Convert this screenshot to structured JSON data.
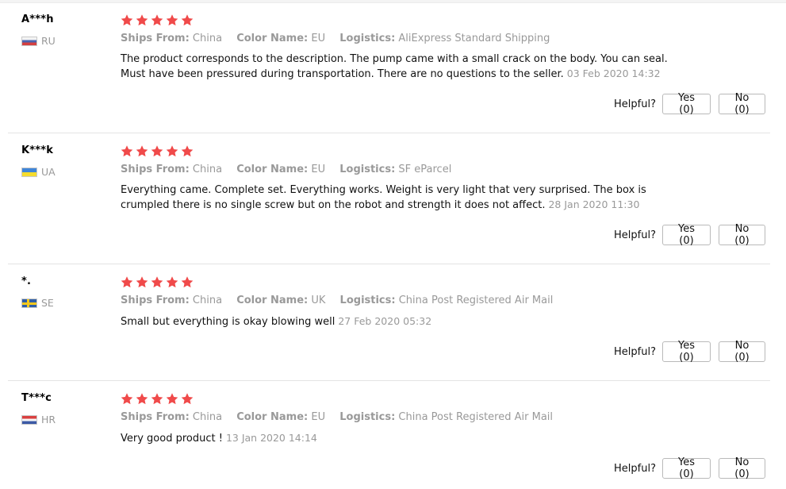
{
  "labels": {
    "ships_from": "Ships From:",
    "color_name": "Color Name:",
    "logistics": "Logistics:",
    "helpful": "Helpful?"
  },
  "colors": {
    "star": "#f04a4a",
    "muted_text": "#999999",
    "divider": "#e3e3e3"
  },
  "reviews": [
    {
      "user": "A***h",
      "country": "RU",
      "flag_icon": "russia-flag-icon",
      "rating": 5,
      "ships_from": "China",
      "color_name": "EU",
      "logistics": "AliExpress Standard Shipping",
      "text": "The product corresponds to the description. The pump came with a small crack on the body. You can seal. Must have been pressured during transportation. There are no questions to the seller.",
      "date": "03 Feb 2020 14:32",
      "yes_label": "Yes (0)",
      "no_label": "No (0)"
    },
    {
      "user": "K***k",
      "country": "UA",
      "flag_icon": "ukraine-flag-icon",
      "rating": 5,
      "ships_from": "China",
      "color_name": "EU",
      "logistics": "SF eParcel",
      "text": "Everything came. Complete set. Everything works. Weight is very light that very surprised. The box is crumpled there is no single screw but on the robot and strength it does not affect.",
      "date": "28 Jan 2020 11:30",
      "yes_label": "Yes (0)",
      "no_label": "No (0)"
    },
    {
      "user": "*.",
      "country": "SE",
      "flag_icon": "sweden-flag-icon",
      "rating": 5,
      "ships_from": "China",
      "color_name": "UK",
      "logistics": "China Post Registered Air Mail",
      "text": "Small but everything is okay blowing well",
      "date": "27 Feb 2020 05:32",
      "yes_label": "Yes (0)",
      "no_label": "No (0)"
    },
    {
      "user": "T***c",
      "country": "HR",
      "flag_icon": "croatia-flag-icon",
      "rating": 5,
      "ships_from": "China",
      "color_name": "EU",
      "logistics": "China Post Registered Air Mail",
      "text": "Very good product !",
      "date": "13 Jan 2020 14:14",
      "yes_label": "Yes (0)",
      "no_label": "No (0)"
    }
  ]
}
